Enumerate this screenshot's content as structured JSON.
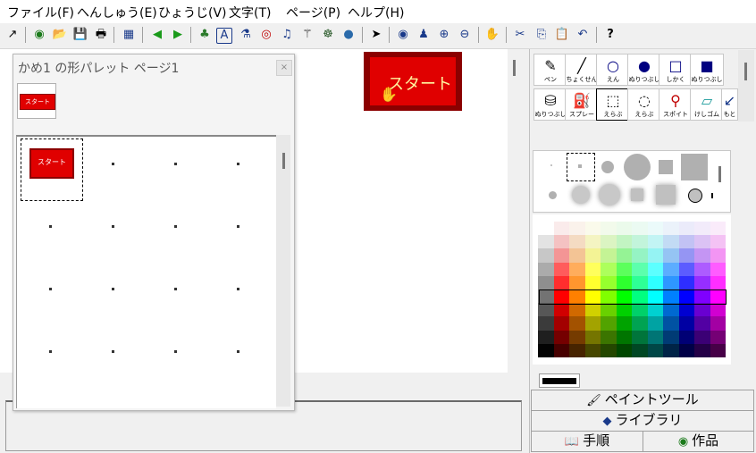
{
  "menu": [
    "ファイル(F)",
    "へんしゅう(E)",
    "ひょうじ(V)",
    "文字(T)",
    "ページ(P)",
    "ヘルプ(H)"
  ],
  "toolbar": [
    {
      "icon": "new-window-icon",
      "glyph": "↗"
    },
    {
      "icon": "globe-icon",
      "glyph": "◉"
    },
    {
      "icon": "folder-open-icon",
      "glyph": "📂"
    },
    {
      "icon": "save-icon",
      "glyph": "💾"
    },
    {
      "icon": "print-icon",
      "glyph": "🖶"
    },
    {
      "icon": "layout-icon",
      "glyph": "▦"
    },
    {
      "icon": "back-arrow-icon",
      "glyph": "◀"
    },
    {
      "icon": "forward-arrow-icon",
      "glyph": "▶"
    },
    {
      "icon": "character-icon",
      "glyph": "♣"
    },
    {
      "icon": "text-icon",
      "glyph": "A"
    },
    {
      "icon": "paint-icon",
      "glyph": "⚗"
    },
    {
      "icon": "eye-icon",
      "glyph": "◎"
    },
    {
      "icon": "music-icon",
      "glyph": "♫"
    },
    {
      "icon": "magic-wand-icon",
      "glyph": "⚚"
    },
    {
      "icon": "movie-icon",
      "glyph": "☸"
    },
    {
      "icon": "globe-alt-icon",
      "glyph": "●"
    },
    {
      "icon": "pointer-icon",
      "glyph": "➤"
    },
    {
      "icon": "view-icon",
      "glyph": "◉"
    },
    {
      "icon": "stamp-icon",
      "glyph": "♟"
    },
    {
      "icon": "zoom-in-icon",
      "glyph": "⊕"
    },
    {
      "icon": "zoom-out-icon",
      "glyph": "⊖"
    },
    {
      "icon": "stop-hand-icon",
      "glyph": "✋"
    },
    {
      "icon": "cut-icon",
      "glyph": "✂"
    },
    {
      "icon": "copy-icon",
      "glyph": "⎘"
    },
    {
      "icon": "paste-icon",
      "glyph": "📋"
    },
    {
      "icon": "undo-icon",
      "glyph": "↶"
    },
    {
      "icon": "help-icon",
      "glyph": "?"
    }
  ],
  "canvas": {
    "sprite_label": "スタート"
  },
  "palette": {
    "title": "かめ1 の形パレット ページ1",
    "close_glyph": "×",
    "thumb_label": "スタート",
    "grid_sprite_label": "スタート"
  },
  "tools_row1": [
    {
      "icon": "pen-icon",
      "label": "ペン",
      "glyph": "✎"
    },
    {
      "icon": "line-icon",
      "label": "ちょくせん",
      "glyph": "╱"
    },
    {
      "icon": "circle-icon",
      "label": "えん",
      "glyph": "○"
    },
    {
      "icon": "filled-circle-icon",
      "label": "ぬりつぶし",
      "glyph": "●"
    },
    {
      "icon": "rectangle-icon",
      "label": "しかく",
      "glyph": "□"
    },
    {
      "icon": "filled-rectangle-icon",
      "label": "ぬりつぶし",
      "glyph": "■"
    }
  ],
  "tools_row2": [
    {
      "icon": "bucket-icon",
      "label": "ぬりつぶし",
      "glyph": "⛁"
    },
    {
      "icon": "spray-icon",
      "label": "スプレー",
      "glyph": "⛽"
    },
    {
      "icon": "rect-select-icon",
      "label": "えらぶ",
      "glyph": "⬚"
    },
    {
      "icon": "lasso-icon",
      "label": "えらぶ",
      "glyph": "◌"
    },
    {
      "icon": "dropper-icon",
      "label": "スポイト",
      "glyph": "⚲"
    },
    {
      "icon": "eraser-icon",
      "label": "けしゴム",
      "glyph": "▱"
    },
    {
      "icon": "undo-tool-icon",
      "label": "もと",
      "glyph": "↙"
    }
  ],
  "bottom_tabs": {
    "paint_tool": "ペイントツール",
    "library": "ライブラリ",
    "procedure": "手順",
    "works": "作品"
  },
  "colors": {
    "accent_red": "#e00000",
    "sprite_text": "#fff7a0",
    "current_color": "#000000"
  }
}
